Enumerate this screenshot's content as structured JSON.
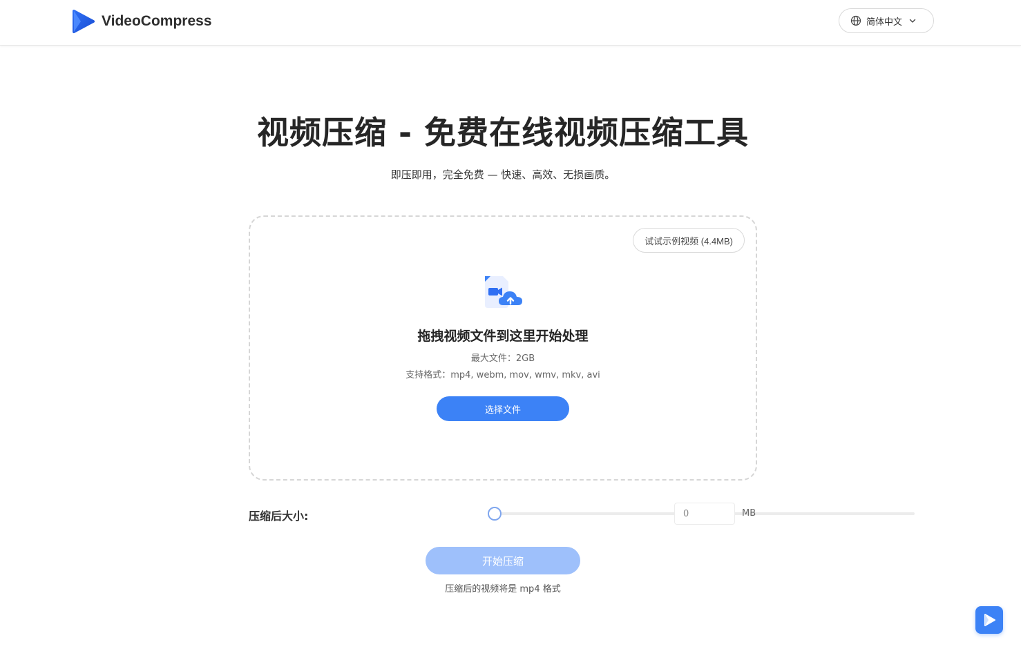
{
  "header": {
    "brand_name": "VideoCompress",
    "language_label": "简体中文"
  },
  "hero": {
    "title": "视频压缩 - 免费在线视频压缩工具",
    "subtitle": "即压即用，完全免费 — 快速、高效、无损画质。"
  },
  "dropzone": {
    "sample_label": "试试示例视频 (4.4MB)",
    "title": "拖拽视频文件到这里开始处理",
    "max_size": "最大文件：2GB",
    "formats": "支持格式：mp4, webm, mov, wmv, mkv, avi",
    "choose_label": "选择文件"
  },
  "compression": {
    "size_label": "压缩后大小:",
    "size_value": "0",
    "slider_value_fraction": 0.0,
    "unit": "MB"
  },
  "actions": {
    "start_label": "开始压缩",
    "output_note": "压缩后的视频将是 mp4 格式"
  },
  "icons": {
    "logo": "play-logo-icon",
    "language": "globe-icon",
    "dropdown": "chevron-down-icon",
    "upload": "video-cloud-upload-icon",
    "floating": "play-logo-icon"
  },
  "colors": {
    "primary": "#3c82f6",
    "primary_disabled": "#9ec0fb",
    "title_text": "#262626"
  }
}
